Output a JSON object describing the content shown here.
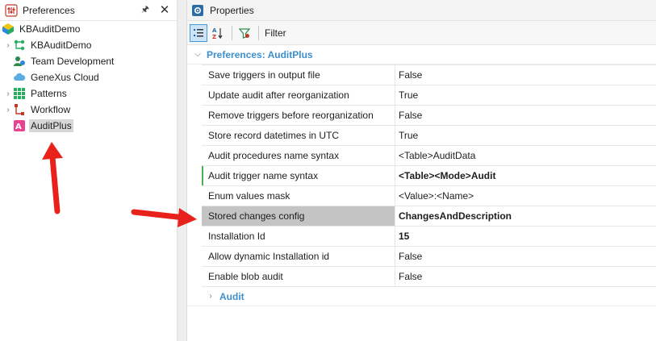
{
  "preferences_pane": {
    "title": "Preferences",
    "tree": [
      {
        "label": "KBAuditDemo",
        "icon": "kb-icon",
        "level": 0,
        "expandable": false
      },
      {
        "label": "KBAuditDemo",
        "icon": "version-tree-icon",
        "level": 1,
        "expandable": true
      },
      {
        "label": "Team Development",
        "icon": "team-icon",
        "level": 1,
        "expandable": false
      },
      {
        "label": "GeneXus Cloud",
        "icon": "cloud-icon",
        "level": 1,
        "expandable": false
      },
      {
        "label": "Patterns",
        "icon": "patterns-icon",
        "level": 1,
        "expandable": true
      },
      {
        "label": "Workflow",
        "icon": "workflow-icon",
        "level": 1,
        "expandable": true
      },
      {
        "label": "AuditPlus",
        "icon": "auditplus-icon",
        "level": 1,
        "expandable": false,
        "selected": true
      }
    ]
  },
  "properties_pane": {
    "title": "Properties",
    "toolbar": {
      "filter_label": "Filter"
    },
    "section_title": "Preferences: AuditPlus",
    "rows": [
      {
        "name": "Save triggers in output file",
        "value": "False"
      },
      {
        "name": "Update audit after reorganization",
        "value": "True"
      },
      {
        "name": "Remove triggers before reorganization",
        "value": "False"
      },
      {
        "name": "Store record datetimes in UTC",
        "value": "True"
      },
      {
        "name": "Audit procedures name syntax",
        "value": "<Table>AuditData"
      },
      {
        "name": "Audit trigger name syntax",
        "value": "<Table><Mode>Audit",
        "bold": true,
        "modified": true
      },
      {
        "name": "Enum values mask",
        "value": "<Value>:<Name>"
      },
      {
        "name": "Stored changes config",
        "value": "ChangesAndDescription",
        "bold": true,
        "selected": true
      },
      {
        "name": "Installation Id",
        "value": "15",
        "bold": true
      },
      {
        "name": "Allow dynamic Installation id",
        "value": "False"
      },
      {
        "name": "Enable blob audit",
        "value": "False"
      }
    ],
    "subsection_title": "Audit"
  },
  "colors": {
    "section_header": "#3b8fcf",
    "annotation_arrow": "#e8211c",
    "selected_row": "#c4c4c4",
    "modified_marker": "#4caf50"
  }
}
